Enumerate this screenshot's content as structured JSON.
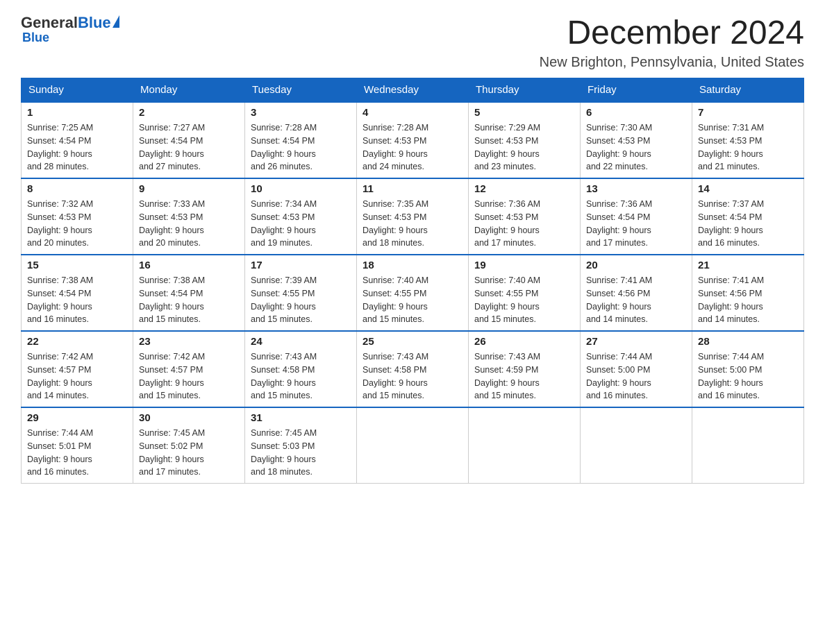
{
  "header": {
    "logo_general": "General",
    "logo_blue": "Blue",
    "month_title": "December 2024",
    "location": "New Brighton, Pennsylvania, United States"
  },
  "days_of_week": [
    "Sunday",
    "Monday",
    "Tuesday",
    "Wednesday",
    "Thursday",
    "Friday",
    "Saturday"
  ],
  "weeks": [
    [
      {
        "day": "1",
        "sunrise": "7:25 AM",
        "sunset": "4:54 PM",
        "daylight": "9 hours and 28 minutes."
      },
      {
        "day": "2",
        "sunrise": "7:27 AM",
        "sunset": "4:54 PM",
        "daylight": "9 hours and 27 minutes."
      },
      {
        "day": "3",
        "sunrise": "7:28 AM",
        "sunset": "4:54 PM",
        "daylight": "9 hours and 26 minutes."
      },
      {
        "day": "4",
        "sunrise": "7:28 AM",
        "sunset": "4:53 PM",
        "daylight": "9 hours and 24 minutes."
      },
      {
        "day": "5",
        "sunrise": "7:29 AM",
        "sunset": "4:53 PM",
        "daylight": "9 hours and 23 minutes."
      },
      {
        "day": "6",
        "sunrise": "7:30 AM",
        "sunset": "4:53 PM",
        "daylight": "9 hours and 22 minutes."
      },
      {
        "day": "7",
        "sunrise": "7:31 AM",
        "sunset": "4:53 PM",
        "daylight": "9 hours and 21 minutes."
      }
    ],
    [
      {
        "day": "8",
        "sunrise": "7:32 AM",
        "sunset": "4:53 PM",
        "daylight": "9 hours and 20 minutes."
      },
      {
        "day": "9",
        "sunrise": "7:33 AM",
        "sunset": "4:53 PM",
        "daylight": "9 hours and 20 minutes."
      },
      {
        "day": "10",
        "sunrise": "7:34 AM",
        "sunset": "4:53 PM",
        "daylight": "9 hours and 19 minutes."
      },
      {
        "day": "11",
        "sunrise": "7:35 AM",
        "sunset": "4:53 PM",
        "daylight": "9 hours and 18 minutes."
      },
      {
        "day": "12",
        "sunrise": "7:36 AM",
        "sunset": "4:53 PM",
        "daylight": "9 hours and 17 minutes."
      },
      {
        "day": "13",
        "sunrise": "7:36 AM",
        "sunset": "4:54 PM",
        "daylight": "9 hours and 17 minutes."
      },
      {
        "day": "14",
        "sunrise": "7:37 AM",
        "sunset": "4:54 PM",
        "daylight": "9 hours and 16 minutes."
      }
    ],
    [
      {
        "day": "15",
        "sunrise": "7:38 AM",
        "sunset": "4:54 PM",
        "daylight": "9 hours and 16 minutes."
      },
      {
        "day": "16",
        "sunrise": "7:38 AM",
        "sunset": "4:54 PM",
        "daylight": "9 hours and 15 minutes."
      },
      {
        "day": "17",
        "sunrise": "7:39 AM",
        "sunset": "4:55 PM",
        "daylight": "9 hours and 15 minutes."
      },
      {
        "day": "18",
        "sunrise": "7:40 AM",
        "sunset": "4:55 PM",
        "daylight": "9 hours and 15 minutes."
      },
      {
        "day": "19",
        "sunrise": "7:40 AM",
        "sunset": "4:55 PM",
        "daylight": "9 hours and 15 minutes."
      },
      {
        "day": "20",
        "sunrise": "7:41 AM",
        "sunset": "4:56 PM",
        "daylight": "9 hours and 14 minutes."
      },
      {
        "day": "21",
        "sunrise": "7:41 AM",
        "sunset": "4:56 PM",
        "daylight": "9 hours and 14 minutes."
      }
    ],
    [
      {
        "day": "22",
        "sunrise": "7:42 AM",
        "sunset": "4:57 PM",
        "daylight": "9 hours and 14 minutes."
      },
      {
        "day": "23",
        "sunrise": "7:42 AM",
        "sunset": "4:57 PM",
        "daylight": "9 hours and 15 minutes."
      },
      {
        "day": "24",
        "sunrise": "7:43 AM",
        "sunset": "4:58 PM",
        "daylight": "9 hours and 15 minutes."
      },
      {
        "day": "25",
        "sunrise": "7:43 AM",
        "sunset": "4:58 PM",
        "daylight": "9 hours and 15 minutes."
      },
      {
        "day": "26",
        "sunrise": "7:43 AM",
        "sunset": "4:59 PM",
        "daylight": "9 hours and 15 minutes."
      },
      {
        "day": "27",
        "sunrise": "7:44 AM",
        "sunset": "5:00 PM",
        "daylight": "9 hours and 16 minutes."
      },
      {
        "day": "28",
        "sunrise": "7:44 AM",
        "sunset": "5:00 PM",
        "daylight": "9 hours and 16 minutes."
      }
    ],
    [
      {
        "day": "29",
        "sunrise": "7:44 AM",
        "sunset": "5:01 PM",
        "daylight": "9 hours and 16 minutes."
      },
      {
        "day": "30",
        "sunrise": "7:45 AM",
        "sunset": "5:02 PM",
        "daylight": "9 hours and 17 minutes."
      },
      {
        "day": "31",
        "sunrise": "7:45 AM",
        "sunset": "5:03 PM",
        "daylight": "9 hours and 18 minutes."
      },
      null,
      null,
      null,
      null
    ]
  ],
  "labels": {
    "sunrise": "Sunrise:",
    "sunset": "Sunset:",
    "daylight": "Daylight:"
  }
}
